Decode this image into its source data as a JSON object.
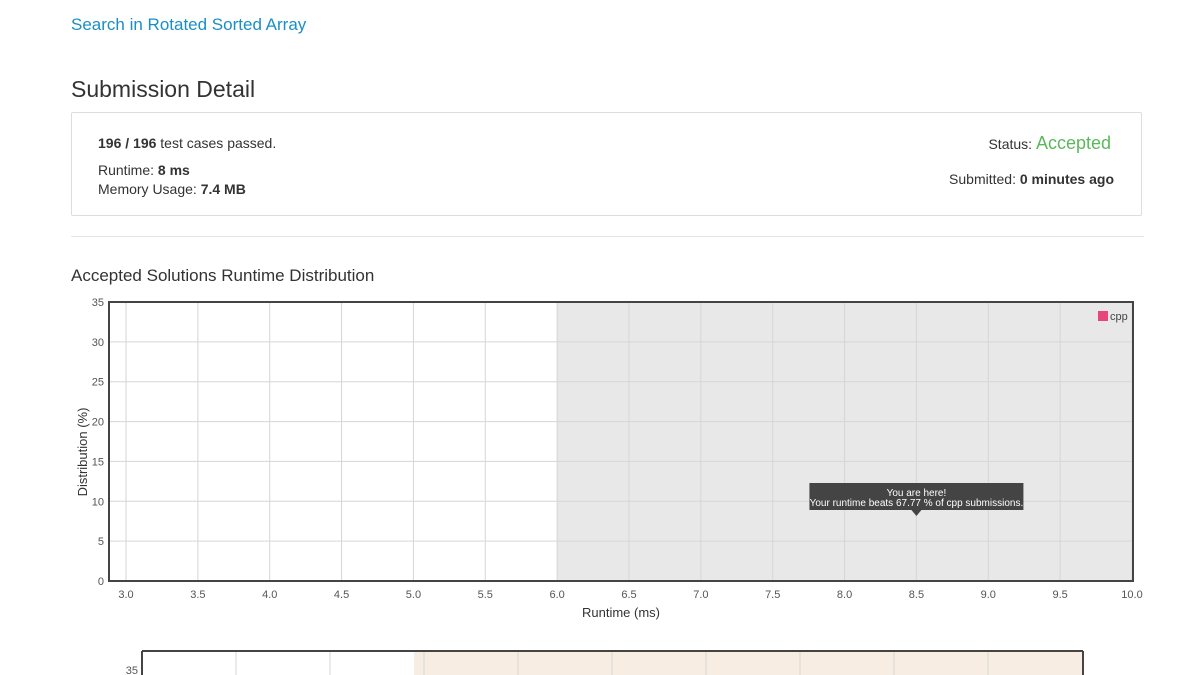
{
  "problem_link": "Search in Rotated Sorted Array",
  "page_title": "Submission Detail",
  "summary": {
    "cases_passed": "196 / 196",
    "cases_suffix": " test cases passed.",
    "runtime_label": "Runtime: ",
    "runtime_value": "8 ms",
    "memory_label": "Memory Usage: ",
    "memory_value": "7.4 MB",
    "status_label": "Status: ",
    "status_value": "Accepted",
    "submitted_label": "Submitted: ",
    "submitted_value": "0 minutes ago"
  },
  "colors": {
    "link": "#1a8fc4",
    "accepted": "#5cb85c",
    "series": "#e8457a",
    "highlight_band": "#e8e8e8",
    "memory_band": "#f7ede2"
  },
  "runtime_chart": {
    "title": "Accepted Solutions Runtime Distribution",
    "chart_data": {
      "type": "bar",
      "title": "",
      "xlabel": "Runtime (ms)",
      "ylabel": "Distribution (%)",
      "xlim": [
        3.0,
        10.0
      ],
      "ylim": [
        0,
        35
      ],
      "x_ticks": [
        "3.0",
        "3.5",
        "4.0",
        "4.5",
        "5.0",
        "5.5",
        "6.0",
        "6.5",
        "7.0",
        "7.5",
        "8.0",
        "8.5",
        "9.0",
        "9.5",
        "10.0"
      ],
      "y_ticks": [
        "0",
        "5",
        "10",
        "15",
        "20",
        "25",
        "30",
        "35"
      ],
      "highlight_from": 6.0,
      "highlight_to": 10.0,
      "series": [
        {
          "name": "cpp",
          "values": []
        }
      ],
      "legend": "top-right",
      "grid": true,
      "tooltip": {
        "x": 8.5,
        "line1": "You are here!",
        "line2": "Your runtime beats 67.77 % of cpp submissions."
      }
    }
  },
  "memory_chart": {
    "chart_data": {
      "type": "bar",
      "ylim": [
        0,
        35
      ],
      "y_ticks": [
        "35"
      ],
      "grid": true,
      "highlight": true
    }
  }
}
